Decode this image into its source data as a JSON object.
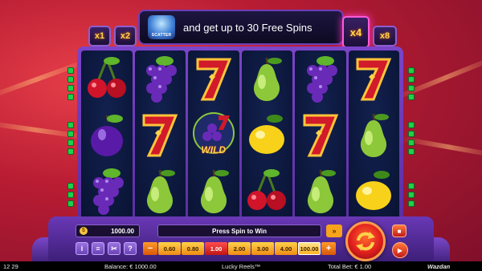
{
  "banner": {
    "text": "and get up to 30 Free Spins",
    "scatter_label": "SCATTER"
  },
  "multipliers": {
    "m1": "x1",
    "m2": "x2",
    "m4": "x4",
    "m8": "x8"
  },
  "reels": [
    [
      "cherry",
      "plum",
      "grapes"
    ],
    [
      "grapes",
      "seven",
      "pear"
    ],
    [
      "seven",
      "wild",
      "pear"
    ],
    [
      "pear",
      "lemon",
      "cherry"
    ],
    [
      "grapes",
      "seven",
      "pear"
    ],
    [
      "seven",
      "pear",
      "lemon"
    ]
  ],
  "wild_label": "WILD",
  "panel": {
    "credit": "1000.00",
    "message": "Press Spin to Win",
    "chevron": "»",
    "icons": [
      "i",
      "≡",
      "✂",
      "?"
    ],
    "bets": [
      "0.60",
      "0.80",
      "1.00",
      "2.00",
      "3.00",
      "4.00",
      "100.00"
    ],
    "selected_bet": "1.00",
    "minus": "−",
    "plus": "+"
  },
  "status": {
    "time": "12 29",
    "balance": "Balance: € 1000.00",
    "title": "Lucky Reels™",
    "total_bet": "Total Bet: € 1.00",
    "logo": "Wazdan"
  }
}
